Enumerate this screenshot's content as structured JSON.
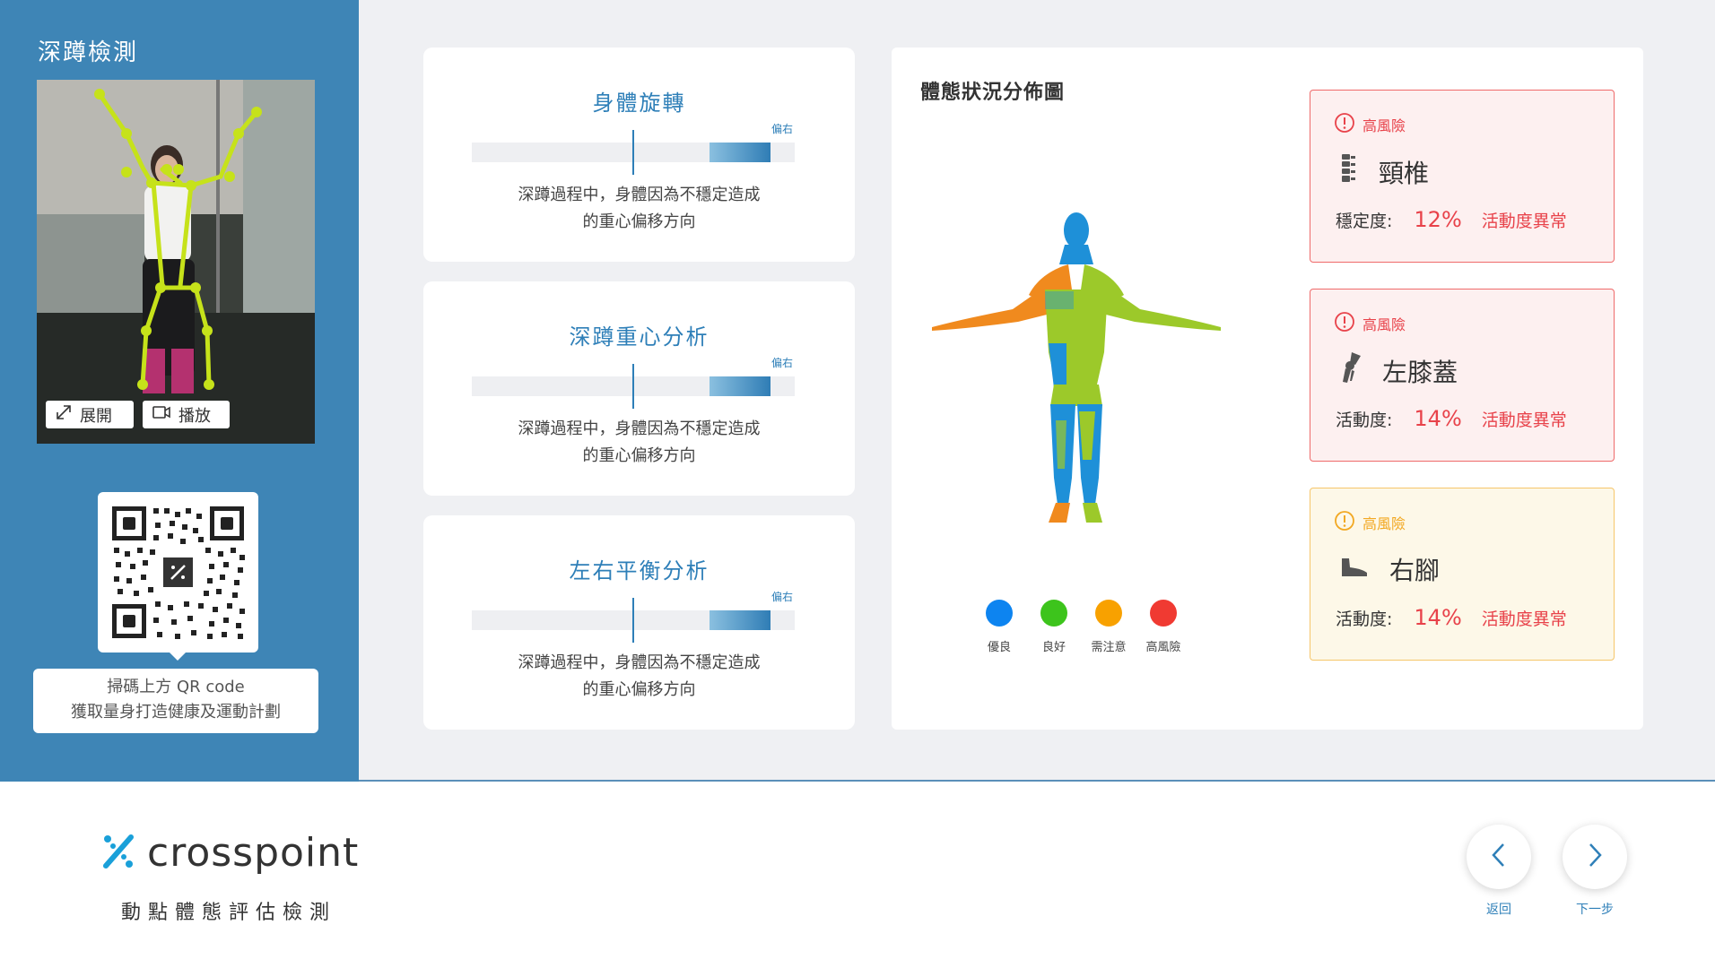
{
  "left_panel": {
    "title": "深蹲檢測",
    "expand_label": "展開",
    "play_label": "播放",
    "qr_caption_line1": "掃碼上方 QR code",
    "qr_caption_line2": "獲取量身打造健康及運動計劃"
  },
  "analysis_cards": [
    {
      "title": "身體旋轉",
      "tag": "偏右",
      "desc_line1": "深蹲過程中，身體因為不穩定造成",
      "desc_line2": "的重心偏移方向"
    },
    {
      "title": "深蹲重心分析",
      "tag": "偏右",
      "desc_line1": "深蹲過程中，身體因為不穩定造成",
      "desc_line2": "的重心偏移方向"
    },
    {
      "title": "左右平衡分析",
      "tag": "偏右",
      "desc_line1": "深蹲過程中，身體因為不穩定造成",
      "desc_line2": "的重心偏移方向"
    }
  ],
  "distribution": {
    "title": "體態狀況分佈圖",
    "legend": [
      {
        "label": "優良",
        "color": "#0d84f0"
      },
      {
        "label": "良好",
        "color": "#3dc41c"
      },
      {
        "label": "需注意",
        "color": "#f8a100"
      },
      {
        "label": "高風險",
        "color": "#f03a32"
      }
    ]
  },
  "risks": [
    {
      "level": "高風險",
      "name": "頸椎",
      "icon": "spine-icon",
      "metric_label": "穩定度:",
      "percent": "12%",
      "status": "活動度異常",
      "color": "#e8424a"
    },
    {
      "level": "高風險",
      "name": "左膝蓋",
      "icon": "knee-icon",
      "metric_label": "活動度:",
      "percent": "14%",
      "status": "活動度異常",
      "color": "#e8424a"
    },
    {
      "level": "高風險",
      "name": "右腳",
      "icon": "foot-icon",
      "metric_label": "活動度:",
      "percent": "14%",
      "status": "活動度異常",
      "color": "#f2a822"
    }
  ],
  "footer": {
    "brand": "crosspoint",
    "subtitle": "動點體態評估檢測",
    "back_label": "返回",
    "next_label": "下一步"
  }
}
